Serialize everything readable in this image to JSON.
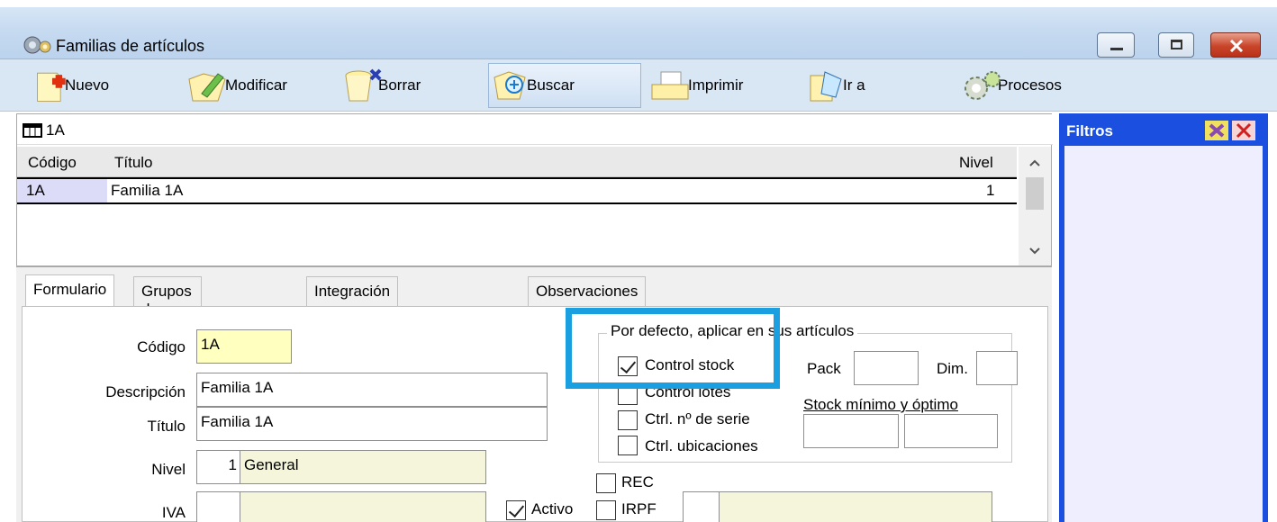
{
  "window": {
    "title": "Familias de artículos"
  },
  "toolbar": {
    "nuevo": "Nuevo",
    "modificar": "Modificar",
    "borrar": "Borrar",
    "buscar": "Buscar",
    "imprimir": "Imprimir",
    "ir_a": "Ir a",
    "procesos": "Procesos"
  },
  "grid": {
    "record_label": "1A",
    "columns": {
      "codigo": "Código",
      "titulo": "Título",
      "nivel": "Nivel"
    },
    "rows": [
      {
        "codigo": "1A",
        "titulo": "Familia 1A",
        "nivel": "1"
      }
    ]
  },
  "tabs": [
    "Formulario",
    "Grupos de familias",
    "Integración con Shopify",
    "Observaciones"
  ],
  "form": {
    "codigo_label": "Código",
    "codigo_value": "1A",
    "descripcion_label": "Descripción",
    "descripcion_value": "Familia 1A",
    "titulo_label": "Título",
    "titulo_value": "Familia 1A",
    "nivel_label": "Nivel",
    "nivel_num": "1",
    "nivel_name": "General",
    "iva_label": "IVA",
    "activo_label": "Activo",
    "rec_label": "REC",
    "irpf_label": "IRPF"
  },
  "defaults_group": {
    "title": "Por defecto, aplicar en sus artículos",
    "control_stock": "Control stock",
    "control_lotes": "Control lotes",
    "ctrl_serie": "Ctrl. nº de serie",
    "ctrl_ubicaciones": "Ctrl. ubicaciones",
    "pack_label": "Pack",
    "dim_label": "Dim.",
    "stock_label": "Stock mínimo y óptimo"
  },
  "filtros": {
    "title": "Filtros"
  },
  "colors": {
    "filtros_bg": "#1a4fe0",
    "highlight": "#1a9fe0"
  }
}
